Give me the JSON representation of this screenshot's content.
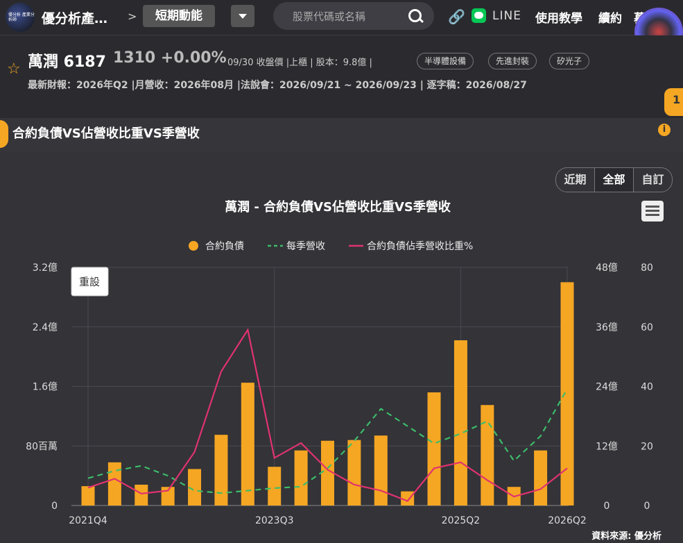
{
  "header": {
    "app_name": "優分析產…",
    "logo_text": "優分析 產業分析師",
    "breadcrumb_sep": ">",
    "page_button": "短期動能",
    "search_placeholder": "股票代碼或名稱",
    "line_label": "LINE",
    "nav": [
      "使用教學",
      "續約",
      "募…人"
    ]
  },
  "stock": {
    "name_code": "萬潤 6187",
    "price_change": "1310 +0.00%",
    "meta": "09/30 收盤價 |上櫃 | 股本：9.8億 |",
    "tags": [
      "半導體設備",
      "先進封裝",
      "矽光子"
    ],
    "info_line": "最新財報：2026年Q2 |月營收：2026年08月 |法說會：2026/09/21 ~ 2026/09/23 | 逐字稿：2026/08/27",
    "side_badge": "1"
  },
  "panel": {
    "title": "合約負債VS佔營收比重VS季營收",
    "range_buttons": [
      "近期",
      "全部",
      "自訂"
    ],
    "active_range": "全部",
    "reset_label": "重設",
    "source": "資料來源: 優分析"
  },
  "colors": {
    "bar": "#f5a623",
    "revenue": "#3dbb6a",
    "ratio": "#e0336e"
  },
  "chart_data": {
    "type": "bar",
    "title": "萬潤 - 合約負債VS佔營收比重VS季營收",
    "categories": [
      "2021Q4",
      "2022Q1",
      "2022Q2",
      "2022Q3",
      "2022Q4",
      "2023Q1",
      "2023Q2",
      "2023Q3",
      "2023Q4",
      "2024Q1",
      "2024Q2",
      "2024Q3",
      "2024Q4",
      "2025Q1",
      "2025Q2",
      "2025Q3",
      "2025Q4",
      "2026Q1",
      "2026Q2"
    ],
    "x_tick_labels": [
      "2021Q4",
      "2023Q3",
      "2025Q2",
      "2026Q2"
    ],
    "series": [
      {
        "name": "合約負債",
        "type": "bar",
        "axis": "left",
        "unit": "億",
        "values": [
          0.26,
          0.58,
          0.28,
          0.25,
          0.49,
          0.95,
          1.65,
          0.52,
          0.74,
          0.87,
          0.88,
          0.94,
          0.19,
          1.52,
          2.22,
          1.35,
          0.25,
          0.74,
          3.0
        ]
      },
      {
        "name": "每季營收",
        "type": "line-dashed",
        "axis": "right-outer",
        "unit": "億",
        "values": [
          5.5,
          7.0,
          8.0,
          6.0,
          3.0,
          2.5,
          3.0,
          3.5,
          3.8,
          7.5,
          13.0,
          19.5,
          16.0,
          12.5,
          14.5,
          17.0,
          9.0,
          14.0,
          23.5
        ]
      },
      {
        "name": "合約負債佔季營收比重%",
        "type": "line",
        "axis": "right-inner",
        "unit": "%",
        "values": [
          6,
          9,
          4,
          5,
          18,
          45,
          59,
          16,
          21,
          12,
          7,
          5,
          1.5,
          12.5,
          14.5,
          8.5,
          3,
          5.5,
          12.5
        ]
      }
    ],
    "y_left": {
      "ticks": [
        "0",
        "80百萬",
        "1.6億",
        "2.4億",
        "3.2億"
      ],
      "range": [
        0,
        3.2
      ]
    },
    "y_right_outer": {
      "ticks": [
        "0",
        "12億",
        "24億",
        "36億",
        "48億"
      ],
      "range": [
        0,
        48
      ]
    },
    "y_right_inner": {
      "ticks": [
        "0",
        "20",
        "40",
        "60",
        "80"
      ],
      "range": [
        0,
        80
      ]
    },
    "grid": true,
    "legend_position": "top-center"
  }
}
